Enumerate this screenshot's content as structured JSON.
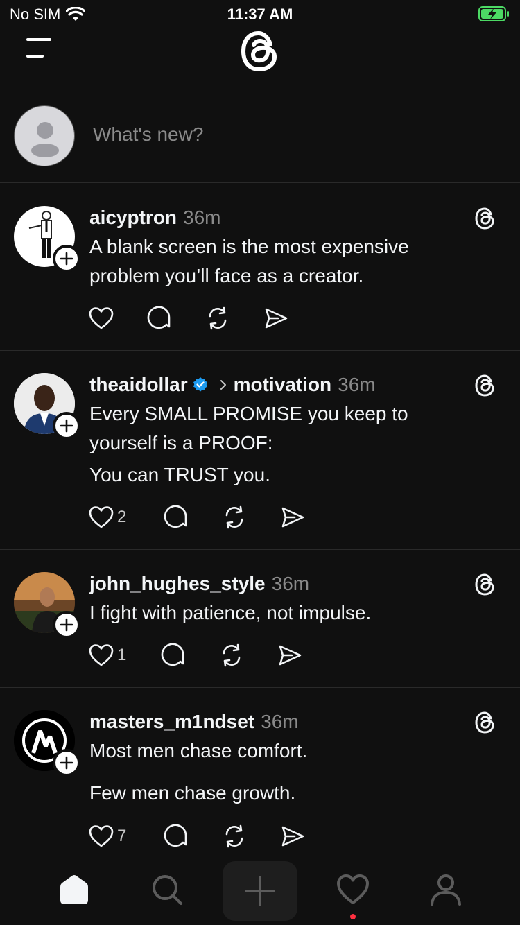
{
  "status_bar": {
    "carrier": "No SIM",
    "time": "11:37 AM"
  },
  "header": {
    "menu_icon": "hamburger-icon",
    "logo_icon": "threads-logo"
  },
  "composer": {
    "placeholder": "What's new?"
  },
  "posts": [
    {
      "username": "aicyptron",
      "verified": false,
      "topic": "",
      "time": "36m",
      "text_lines": [
        "A blank screen is the most expensive",
        "problem you’ll face as a creator."
      ],
      "likes": ""
    },
    {
      "username": "theaidollar",
      "verified": true,
      "topic": "motivation",
      "time": "36m",
      "text_lines": [
        "Every SMALL PROMISE you keep to",
        "yourself is a PROOF:",
        "You can TRUST you."
      ],
      "likes": "2"
    },
    {
      "username": "john_hughes_style",
      "verified": false,
      "topic": "",
      "time": "36m",
      "text_lines": [
        "I fight with patience, not impulse."
      ],
      "likes": "1"
    },
    {
      "username": "masters_m1ndset",
      "verified": false,
      "topic": "",
      "time": "36m",
      "text_lines": [
        "Most men chase comfort.",
        "Few men chase growth."
      ],
      "likes": "7"
    }
  ],
  "bottom_nav": {
    "items": [
      "home-icon",
      "search-icon",
      "plus-icon",
      "heart-icon",
      "profile-icon"
    ],
    "active": "home-icon",
    "notification_color": "#ff3040"
  },
  "colors": {
    "background": "#101010",
    "text": "#f3f5f7",
    "muted": "#8a8a8a",
    "verified": "#1d9bf0"
  }
}
